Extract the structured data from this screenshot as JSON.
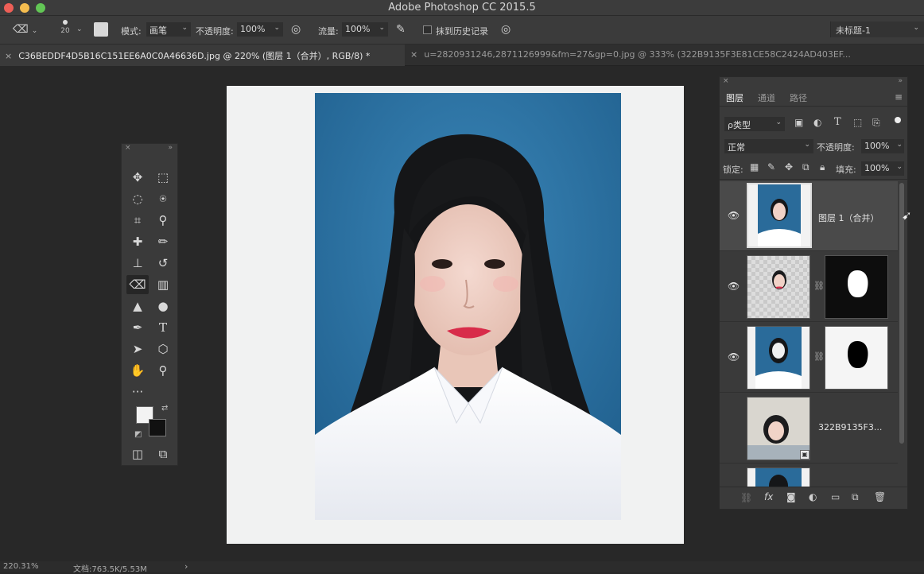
{
  "window": {
    "title": "Adobe Photoshop CC 2015.5"
  },
  "options_bar": {
    "brush_size": "20",
    "mode_label": "模式:",
    "mode_value": "画笔",
    "opacity_label": "不透明度:",
    "opacity_value": "100%",
    "flow_label": "流量:",
    "flow_value": "100%",
    "history_label": "抹到历史记录",
    "document_select": "未标题-1"
  },
  "tabs": [
    {
      "label": "C36BEDDF4D5B16C151EE6A0C0A46636D.jpg @ 220% (图层 1（合并）, RGB/8) *"
    },
    {
      "label": "u=2820931246,2871126999&fm=27&gp=0.jpg @ 333% (322B9135F3E81CE58C2424AD403EF..."
    }
  ],
  "layers_panel": {
    "tabs": [
      "图层",
      "通道",
      "路径"
    ],
    "filter_label": "ρ类型",
    "blend_mode": "正常",
    "opacity_label": "不透明度:",
    "opacity_value": "100%",
    "lock_label": "锁定:",
    "fill_label": "填充:",
    "fill_value": "100%",
    "layers": [
      {
        "name": "图层 1（合并）"
      },
      {
        "name": ""
      },
      {
        "name": ""
      },
      {
        "name": "322B9135F3..."
      },
      {
        "name": ""
      }
    ]
  },
  "status_bar": {
    "zoom": "220.31%",
    "doc_size": "文档:763.5K/5.53M"
  },
  "colors": {
    "accent_red": "#ee5f57",
    "accent_yellow": "#f5bd4f",
    "accent_green": "#62c655",
    "photo_background": "#2a6b9a"
  }
}
